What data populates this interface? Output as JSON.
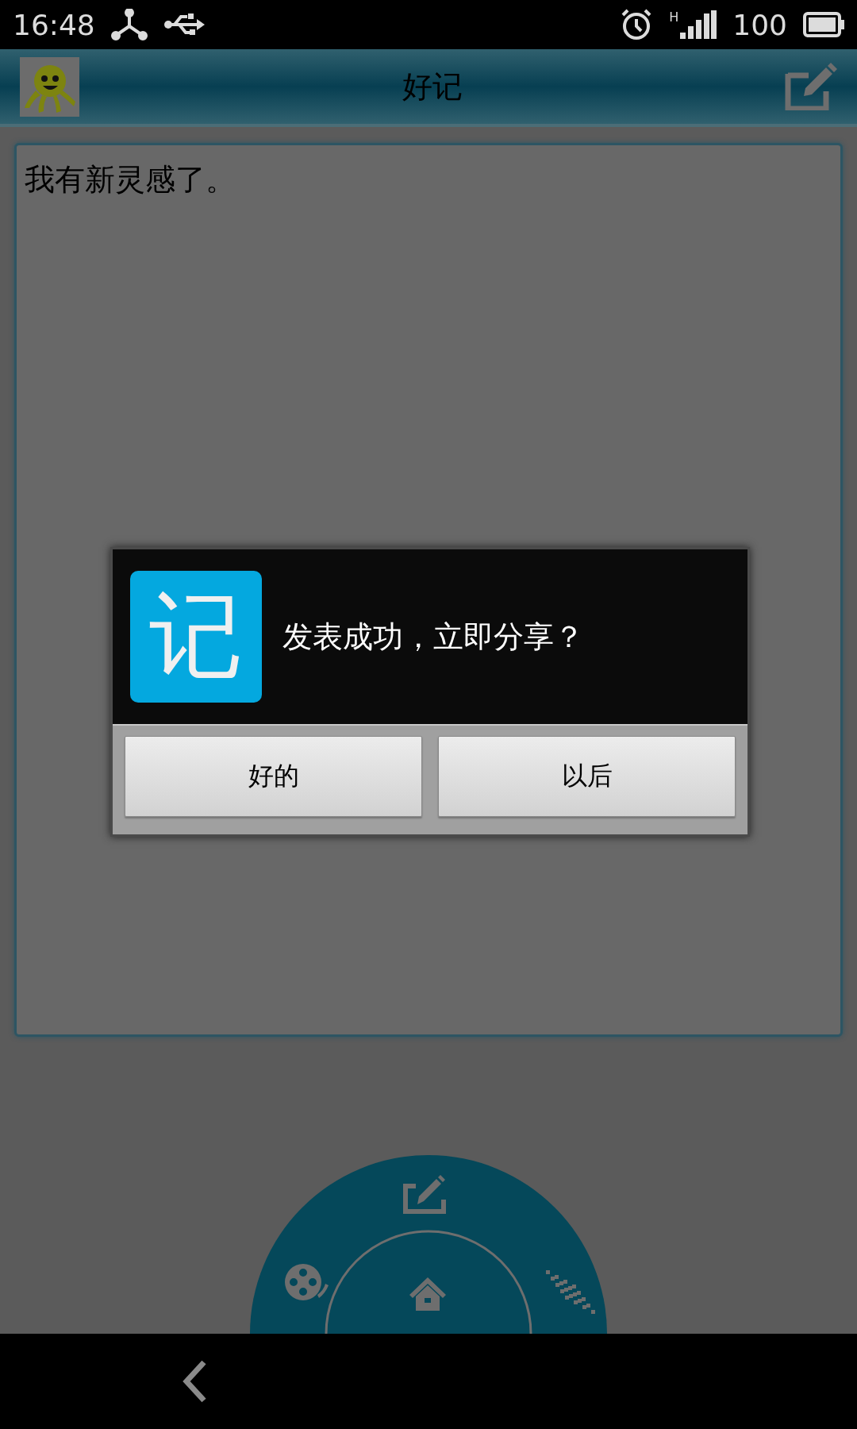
{
  "status_bar": {
    "time": "16:48",
    "network_type": "H",
    "battery": "100"
  },
  "app_bar": {
    "title": "好记"
  },
  "note": {
    "text": "我有新灵感了。"
  },
  "dialog": {
    "icon_text": "记",
    "message": "发表成功，立即分享？",
    "buttons": [
      {
        "label": "好的"
      },
      {
        "label": "以后"
      }
    ]
  }
}
